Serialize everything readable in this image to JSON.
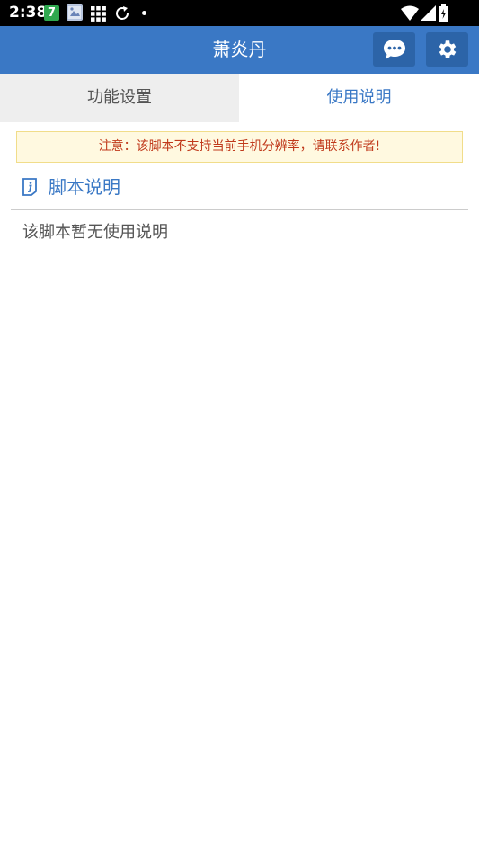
{
  "status_bar": {
    "time": "2:38",
    "badge": "7",
    "badge_color": "#2fa84f",
    "icons": [
      "app-badge-icon",
      "image-notification-icon",
      "grid-icon",
      "sync-icon",
      "dot-icon",
      "wifi-icon",
      "signal-icon",
      "battery-charging-icon"
    ]
  },
  "app_bar": {
    "title": "萧炎丹",
    "color": "#3a78c5",
    "buttons": [
      "message-icon",
      "gear-icon"
    ]
  },
  "tabs": [
    {
      "label": "功能设置",
      "active": false
    },
    {
      "label": "使用说明",
      "active": true
    }
  ],
  "warning": {
    "text": "注意：该脚本不支持当前手机分辨率，请联系作者!",
    "text_color": "#c0391b",
    "bg_color": "#fff9e0"
  },
  "section": {
    "icon": "info-icon",
    "title": "脚本说明",
    "body": "该脚本暂无使用说明"
  }
}
